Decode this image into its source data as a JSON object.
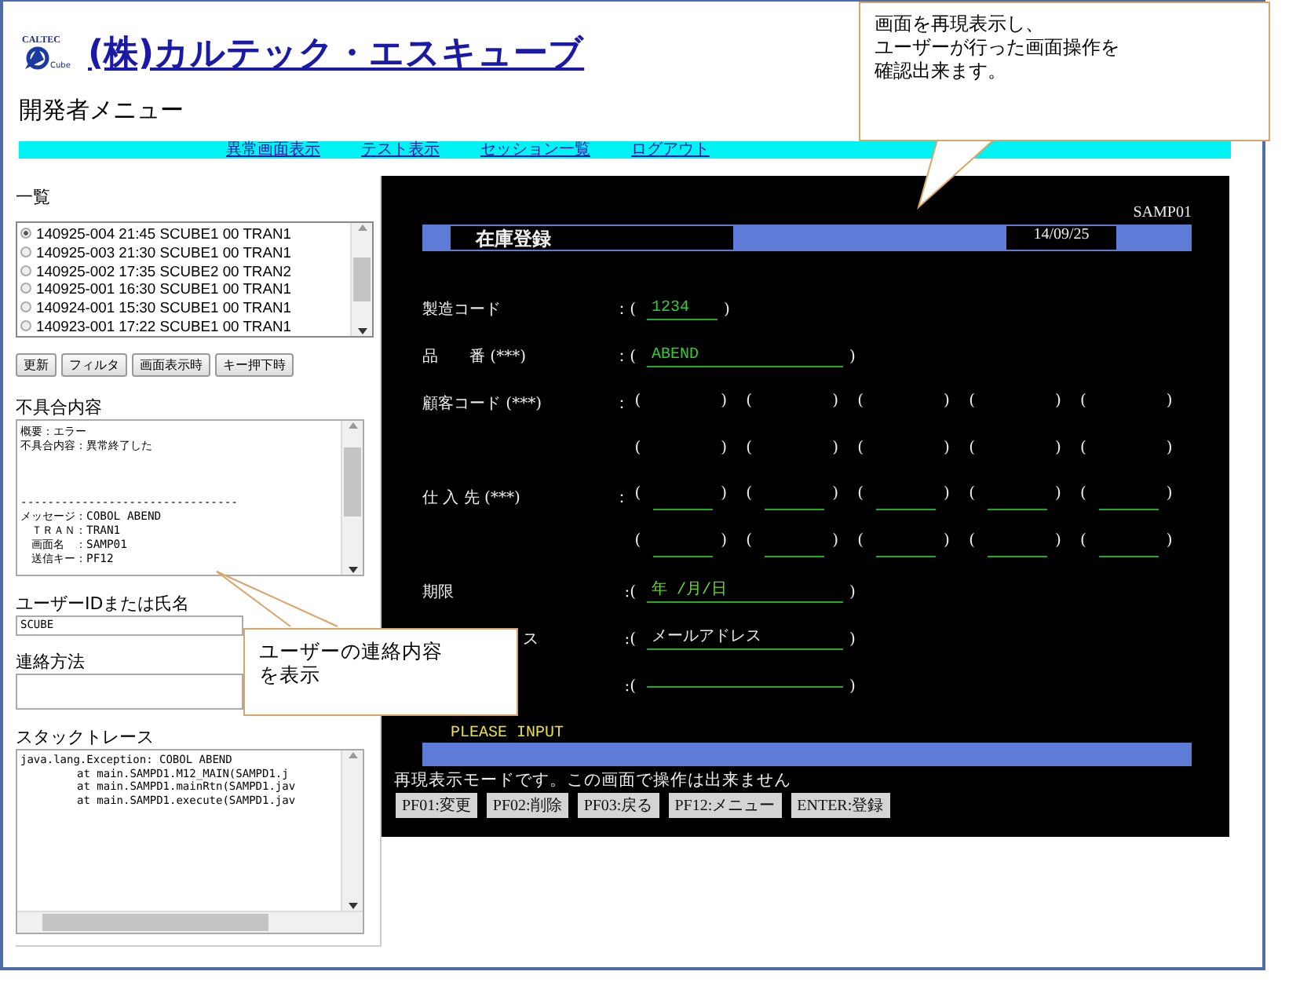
{
  "header": {
    "logo_top": "CALTEC",
    "logo_bottom": "Cube",
    "title": "(株)カルテック・エスキューブ",
    "page_title": "開発者メニュー"
  },
  "nav": [
    {
      "label": "異常画面表示"
    },
    {
      "label": "テスト表示"
    },
    {
      "label": "セッション一覧"
    },
    {
      "label": "ログアウト"
    }
  ],
  "sidebar": {
    "list_title": "一覧",
    "list": [
      {
        "label": "140925-004 21:45 SCUBE1 00 TRAN1",
        "selected": true
      },
      {
        "label": "140925-003 21:30 SCUBE1 00 TRAN1",
        "selected": false
      },
      {
        "label": "140925-002 17:35 SCUBE2 00 TRAN2",
        "selected": false
      },
      {
        "label": "140925-001 16:30 SCUBE1 00 TRAN1",
        "selected": false
      },
      {
        "label": "140924-001 15:30 SCUBE1 00 TRAN1",
        "selected": false
      },
      {
        "label": "140923-001 17:22 SCUBE1 00 TRAN1",
        "selected": false
      }
    ],
    "buttons": [
      "更新",
      "フィルタ",
      "画面表示時",
      "キー押下時"
    ],
    "defect_label": "不具合内容",
    "defect_summary": [
      "概要：エラー",
      "不具合内容：異常終了した"
    ],
    "defect_separator": "--------------------------------",
    "defect_details": [
      "メッセージ：COBOL ABEND",
      "　ＴＲＡＮ：TRAN1",
      "　画面名　：SAMP01",
      "　送信キー：PF12"
    ],
    "user_label": "ユーザーIDまたは氏名",
    "user_value": "SCUBE",
    "contact_label": "連絡方法",
    "stack_label": "スタックトレース",
    "stack_lines": [
      {
        "text": "java.lang.Exception: COBOL ABEND",
        "indent": false
      },
      {
        "text": "at main.SAMPD1.M12_MAIN(SAMPD1.j",
        "indent": true
      },
      {
        "text": "at main.SAMPD1.mainRtn(SAMPD1.jav",
        "indent": true
      },
      {
        "text": "at main.SAMPD1.execute(SAMPD1.jav",
        "indent": true
      }
    ]
  },
  "terminal": {
    "screen_id": "SAMP01",
    "title": "在庫登録",
    "date": "14/09/25",
    "rows": [
      {
        "kind": "short_field",
        "label": "製造コード",
        "open": "：(",
        "value": "1234",
        "color": "#33cc33",
        "close": ")"
      },
      {
        "kind": "long_field",
        "label": "品　　番 (***)",
        "open": "：(",
        "value": "ABEND",
        "color": "#33cc33",
        "close": ")"
      },
      {
        "kind": "groups",
        "label": "顧客コード (***)",
        "open": "：",
        "groups": [
          {
            "open": "(",
            "close": ")",
            "underline": false
          },
          {
            "open": "(",
            "close": ")",
            "underline": false
          },
          {
            "open": "(",
            "close": ")",
            "underline": false
          },
          {
            "open": "(",
            "close": ")",
            "underline": false
          },
          {
            "open": "(",
            "close": ")",
            "underline": false
          }
        ]
      },
      {
        "kind": "groups",
        "groups": [
          {
            "open": "(",
            "close": ")",
            "underline": false
          },
          {
            "open": "(",
            "close": ")",
            "underline": false
          },
          {
            "open": "(",
            "close": ")",
            "underline": false
          },
          {
            "open": "(",
            "close": ")",
            "underline": false
          },
          {
            "open": "(",
            "close": ")",
            "underline": false
          }
        ]
      },
      {
        "kind": "groups",
        "label": "仕 入 先 (***)",
        "open": "：",
        "groups": [
          {
            "open": "(",
            "close": ")",
            "underline": true
          },
          {
            "open": "(",
            "close": ")",
            "underline": true
          },
          {
            "open": "(",
            "close": ")",
            "underline": true
          },
          {
            "open": "(",
            "close": ")",
            "underline": true
          },
          {
            "open": "(",
            "close": ")",
            "underline": true
          }
        ]
      },
      {
        "kind": "groups",
        "groups": [
          {
            "open": "(",
            "close": ")",
            "underline": true
          },
          {
            "open": "(",
            "close": ")",
            "underline": true
          },
          {
            "open": "(",
            "close": ")",
            "underline": true
          },
          {
            "open": "(",
            "close": ")",
            "underline": true
          },
          {
            "open": "(",
            "close": ")",
            "underline": true
          }
        ]
      },
      {
        "kind": "long_field",
        "label": "期限",
        "open": ":(",
        "value": "年 /月/日",
        "color": "#66dd22",
        "close": ")"
      },
      {
        "kind": "long_field",
        "label": "ス",
        "open": ":(",
        "value": "メールアドレス",
        "color": "#e8e8e8",
        "close": ")"
      },
      {
        "kind": "long_field",
        "open": ":(",
        "close": ")"
      }
    ],
    "message": "PLEASE INPUT",
    "notice": "再現表示モードです。この画面で操作は出来ません",
    "keys": [
      "PF01:変更",
      "PF02:削除",
      "PF03:戻る",
      "PF12:メニュー",
      "ENTER:登録"
    ]
  },
  "callouts": [
    {
      "lines": [
        "画面を再現表示し、",
        "ユーザーが行った画面操作を",
        "確認出来ます。"
      ]
    },
    {
      "lines": [
        "ユーザーの連絡内容",
        "を表示"
      ]
    }
  ]
}
